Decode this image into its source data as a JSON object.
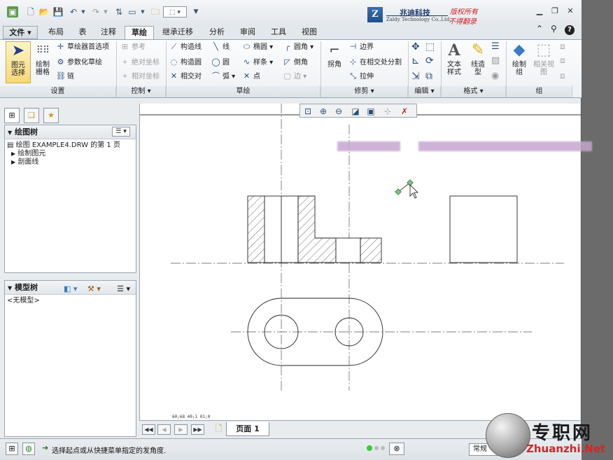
{
  "titlebar": {
    "quick_access": [
      "app-icon",
      "new-icon",
      "open-icon",
      "save-icon",
      "undo-icon",
      "redo-icon",
      "regenerate-icon",
      "windows-icon",
      "folder-icon",
      "select-box-icon",
      "customize-icon"
    ],
    "logo_mark": "Z",
    "logo_name": "兆迪科技",
    "logo_en": "Zaldy Technology Co.,Ltd.",
    "copyright_1": "版权所有",
    "copyright_2": "不得翻录",
    "help_icons": [
      "collapse-icon",
      "search-icon",
      "help-icon"
    ]
  },
  "tabs": [
    {
      "label": "文件",
      "kind": "file"
    },
    {
      "label": "布局"
    },
    {
      "label": "表"
    },
    {
      "label": "注释"
    },
    {
      "label": "草绘",
      "active": true
    },
    {
      "label": "继承迁移"
    },
    {
      "label": "分析"
    },
    {
      "label": "审阅"
    },
    {
      "label": "工具"
    },
    {
      "label": "视图"
    }
  ],
  "ribbon": {
    "settings": {
      "select": "图元\n选择",
      "grid": "绘制\n栅格",
      "items": [
        "草绘器首选项",
        "参数化草绘",
        "链"
      ],
      "label": "设置"
    },
    "control": {
      "items": [
        "参考",
        "绝对坐标",
        "相对坐标"
      ],
      "label": "控制"
    },
    "sketch": {
      "col1": [
        "构造线",
        "构造圆",
        "相交对"
      ],
      "col2": [
        "线",
        "圆",
        "弧"
      ],
      "col3": [
        "椭圆",
        "样条",
        "点"
      ],
      "col4": [
        "圆角",
        "倒角",
        "边"
      ],
      "label": "草绘"
    },
    "trim": {
      "corner": "拐角",
      "items": [
        "边界",
        "在相交处分割",
        "拉伸"
      ],
      "label": "修剪"
    },
    "edit": {
      "label": "编辑"
    },
    "format": {
      "text_style": "文本\n样式",
      "line_style": "线造\n型",
      "label": "格式"
    },
    "group": {
      "draw_group": "绘制\n组",
      "related_view": "相关视\n图",
      "label": "组"
    }
  },
  "left_panel": {
    "drawing_tree_title": "绘图树",
    "drawing_tree_items": [
      "绘图 EXAMPLE4.DRW 的第 1 页",
      "绘制图元",
      "剖面线"
    ],
    "model_tree_title": "模型树",
    "model_tree_empty": "<无模型>"
  },
  "page_nav": {
    "page_label": "页面 1"
  },
  "coord_readout": "60;68   40;1   01;0",
  "status": {
    "message": "选择起点或从快捷菜单指定的发角度.",
    "filter_value": "常规"
  },
  "watermark": {
    "cn": "专职网",
    "en": "Zhuanzhi.Net"
  }
}
